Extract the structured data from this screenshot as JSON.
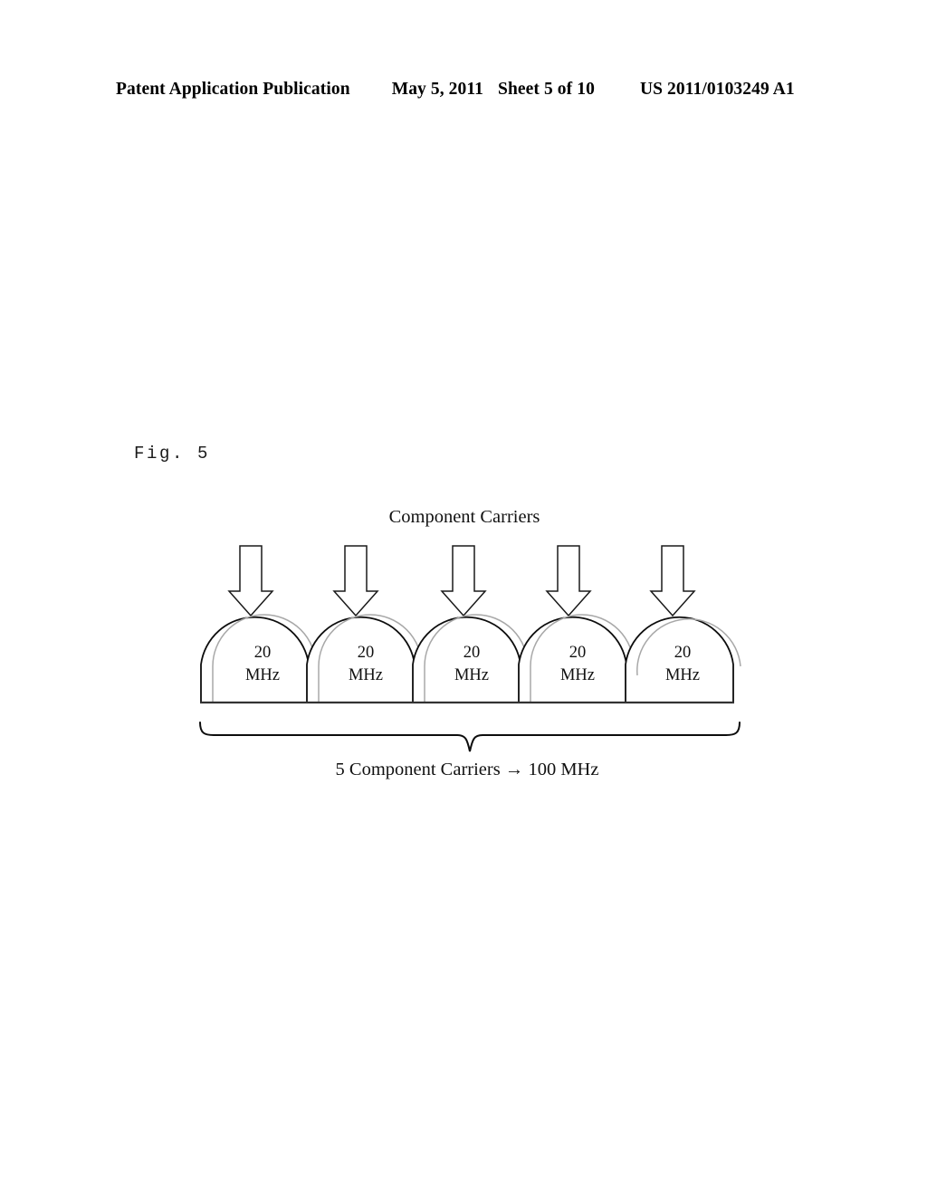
{
  "header": {
    "publication": "Patent Application Publication",
    "date": "May 5, 2011",
    "sheet": "Sheet 5 of 10",
    "patent_number": "US 2011/0103249 A1"
  },
  "figure": {
    "label": "Fig. 5",
    "title": "Component Carriers",
    "caption": "5 Component Carriers → 100 MHz",
    "carriers": [
      {
        "value": "20",
        "unit": "MHz"
      },
      {
        "value": "20",
        "unit": "MHz"
      },
      {
        "value": "20",
        "unit": "MHz"
      },
      {
        "value": "20",
        "unit": "MHz"
      },
      {
        "value": "20",
        "unit": "MHz"
      }
    ],
    "arrows": [
      {
        "name": "down-arrow-1"
      },
      {
        "name": "down-arrow-2"
      },
      {
        "name": "down-arrow-3"
      },
      {
        "name": "down-arrow-4"
      },
      {
        "name": "down-arrow-5"
      }
    ],
    "colors": {
      "outline": "#0d0d0d",
      "inner_arc": "#a8a8a8",
      "baseline": "#333333",
      "text": "#111111",
      "background": "#ffffff"
    }
  }
}
